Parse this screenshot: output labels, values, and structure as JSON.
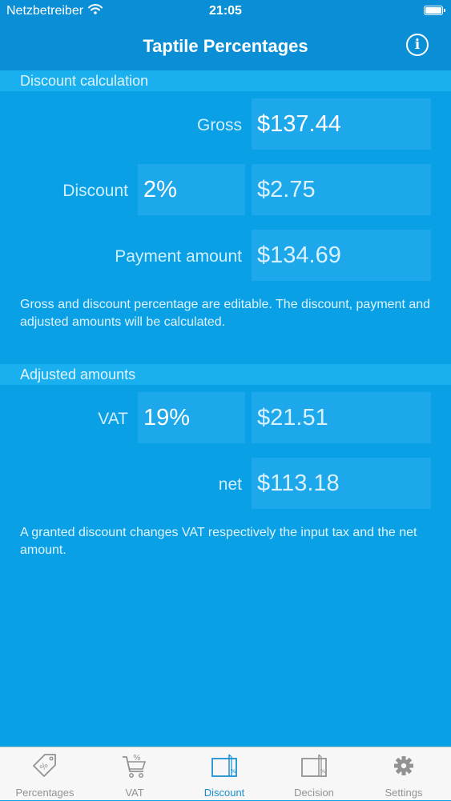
{
  "status": {
    "carrier": "Netzbetreiber",
    "time": "21:05"
  },
  "nav": {
    "title": "Taptile Percentages"
  },
  "discount_section": {
    "header": "Discount calculation",
    "gross_label": "Gross",
    "gross_value": "$137.44",
    "discount_label": "Discount",
    "discount_percent": "2%",
    "discount_amount": "$2.75",
    "payment_label": "Payment amount",
    "payment_value": "$134.69",
    "note": "Gross and discount percentage are editable. The discount, payment and adjusted amounts will be calculated."
  },
  "adjusted_section": {
    "header": "Adjusted amounts",
    "vat_label": "VAT",
    "vat_percent": "19%",
    "vat_amount": "$21.51",
    "net_label": "net",
    "net_value": "$113.18",
    "note": "A granted discount changes VAT respectively the input tax and the net amount."
  },
  "tabs": [
    {
      "label": "Percentages",
      "icon": "tag-percent-icon",
      "active": false
    },
    {
      "label": "VAT",
      "icon": "cart-percent-icon",
      "active": false
    },
    {
      "label": "Discount",
      "icon": "discount-document-icon",
      "active": true
    },
    {
      "label": "Decision",
      "icon": "decision-document-icon",
      "active": false
    },
    {
      "label": "Settings",
      "icon": "gear-icon",
      "active": false
    }
  ],
  "colors": {
    "background": "#0aa0e6",
    "nav_bar": "#0a8fd6",
    "section_header": "#1ab0ef",
    "field": "#1ea8ec",
    "tab_active": "#1a8fd0",
    "tab_inactive": "#929292"
  }
}
